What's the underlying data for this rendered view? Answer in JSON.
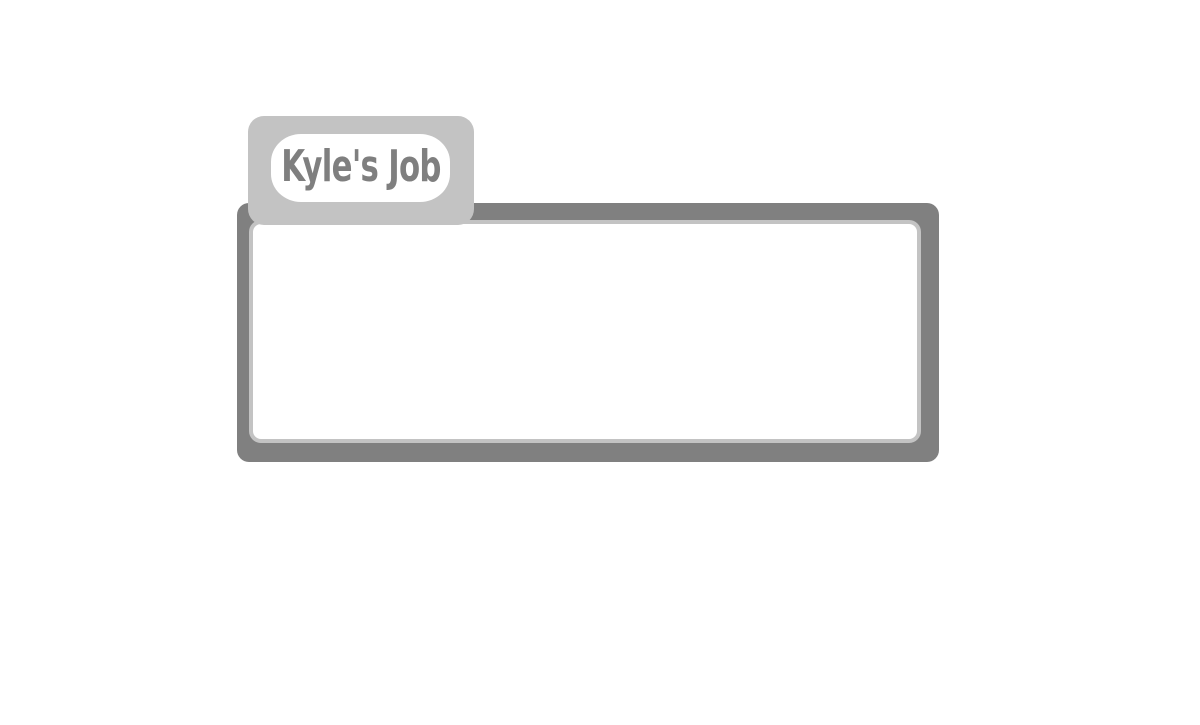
{
  "panel": {
    "title": "Kyle's Job"
  },
  "colors": {
    "frame": "#808080",
    "tab": "#c3c3c3",
    "title_text": "#7f7f7f",
    "panel_body": "#ffffff"
  }
}
